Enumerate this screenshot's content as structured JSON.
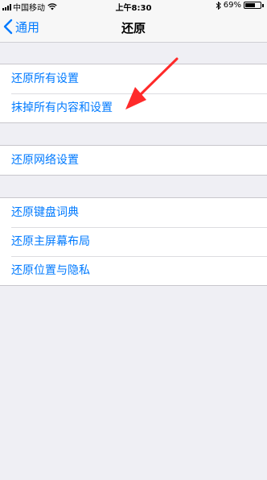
{
  "status": {
    "carrier": "中国移动",
    "time": "上午8:30",
    "battery": "69%",
    "battery_level": 0.69
  },
  "nav": {
    "back_label": "通用",
    "title": "还原"
  },
  "groups": [
    {
      "items": [
        "还原所有设置",
        "抹掉所有内容和设置"
      ]
    },
    {
      "items": [
        "还原网络设置"
      ]
    },
    {
      "items": [
        "还原键盘词典",
        "还原主屏幕布局",
        "还原位置与隐私"
      ]
    }
  ],
  "colors": {
    "accent": "#007aff",
    "annotation_arrow": "#ff2a2a",
    "background": "#efeff4"
  },
  "icons": [
    "signal-icon",
    "wifi-icon",
    "bluetooth-icon",
    "battery-icon",
    "chevron-left-icon",
    "annotation-arrow"
  ]
}
